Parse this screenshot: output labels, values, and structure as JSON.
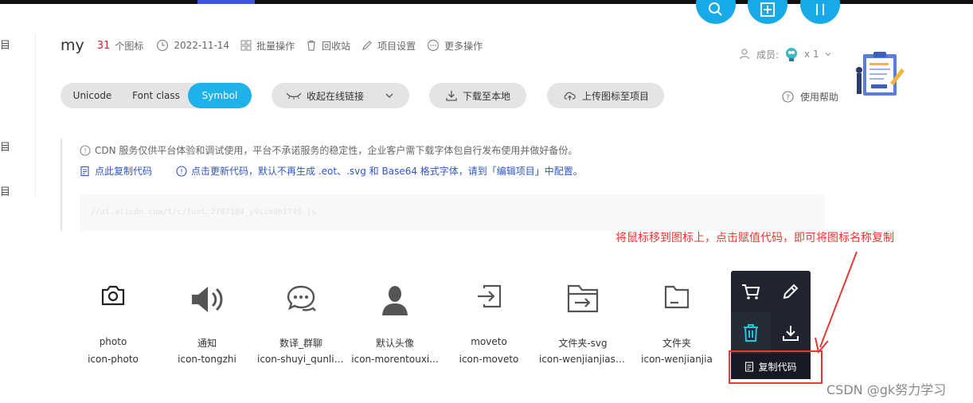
{
  "header": {
    "project_name": "my",
    "icon_count": "31",
    "icon_count_unit": "个图标",
    "date": "2022-11-14",
    "batch_ops": "批量操作",
    "recycle_bin": "回收站",
    "project_settings": "项目设置",
    "more_ops": "更多操作"
  },
  "sidebar_fragments": [
    "目",
    "目",
    "目"
  ],
  "members": {
    "label": "成员:",
    "count": "x 1"
  },
  "help": "使用帮助",
  "tabs": [
    {
      "label": "Unicode",
      "active": false
    },
    {
      "label": "Font class",
      "active": false
    },
    {
      "label": "Symbol",
      "active": true
    }
  ],
  "toolbar": {
    "collapse_link": "收起在线链接",
    "download_local": "下载至本地",
    "upload_to_project": "上传图标至项目"
  },
  "cdn": {
    "notice": "CDN 服务仅供平台体验和调试使用，平台不承诺服务的稳定性，企业客户需下载字体包自行发布使用并做好备份。",
    "copy_code_link": "点此复制代码",
    "update_code_link": "点击更新代码，默认不再生成 .eot、.svg 和 Base64 格式字体，请到「编辑项目」中配置。",
    "code": "//at.alicdn.com/t/c/font_2787184_y4vix9h1749.js"
  },
  "annotation": "将鼠标移到图标上，点击赋值代码，即可将图标名称复制",
  "icons": [
    {
      "name": "photo",
      "code": "icon-photo",
      "glyph": "camera-icon"
    },
    {
      "name": "通知",
      "code": "icon-tongzhi",
      "glyph": "speaker-icon"
    },
    {
      "name": "数译_群聊",
      "code": "icon-shuyi_qunliao",
      "glyph": "chat-icon"
    },
    {
      "name": "默认头像",
      "code": "icon-morentouxi...",
      "glyph": "avatar-icon"
    },
    {
      "name": "moveto",
      "code": "icon-moveto",
      "glyph": "move-to-icon"
    },
    {
      "name": "文件夹-svg",
      "code": "icon-wenjianjiasvg",
      "glyph": "folder-arrow-icon"
    },
    {
      "name": "文件夹",
      "code": "icon-wenjianjia",
      "glyph": "folder-icon"
    }
  ],
  "hover_card": {
    "copy_code": "复制代码"
  },
  "watermark": "CSDN @gk努力学习",
  "colors": {
    "accent": "#1fb2ea",
    "annotation_red": "#e9382f",
    "link_blue": "#2e55c8"
  }
}
